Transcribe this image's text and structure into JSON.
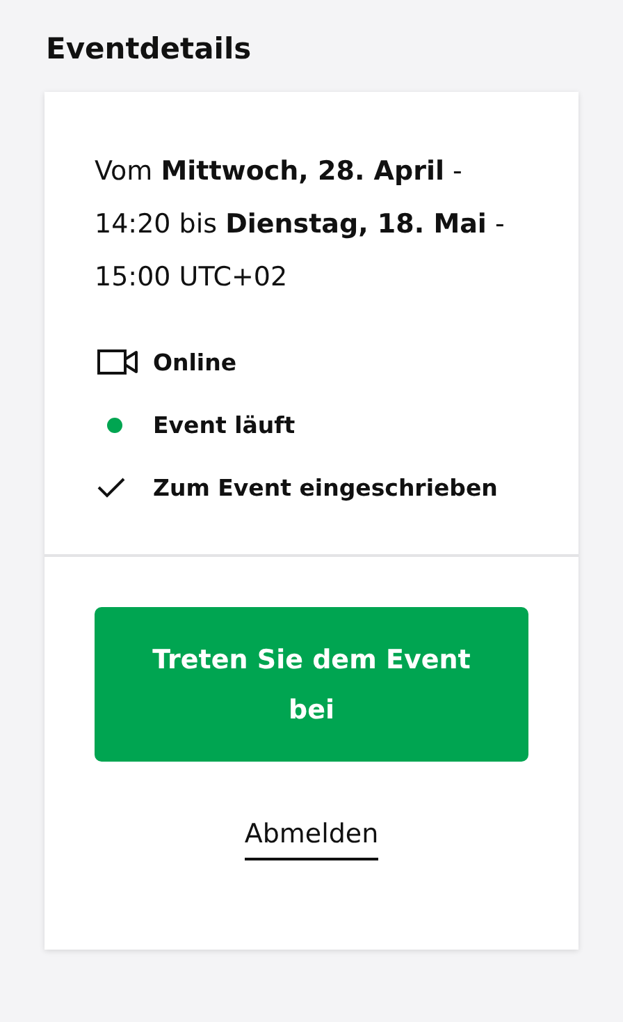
{
  "heading": "Eventdetails",
  "card": {
    "date_text": "Vom **Mittwoch, 28. April** - 14:20 bis **Dienstag, 18. Mai** - 15:00 UTC+02",
    "info": [
      {
        "kind": "video",
        "label": "Online"
      },
      {
        "kind": "status",
        "label": "Event läuft",
        "color": "#00a551"
      },
      {
        "kind": "check",
        "label": "Zum Event eingeschrieben"
      }
    ],
    "join_button": "Treten Sie dem Event bei",
    "leave_link": "Abmelden"
  }
}
